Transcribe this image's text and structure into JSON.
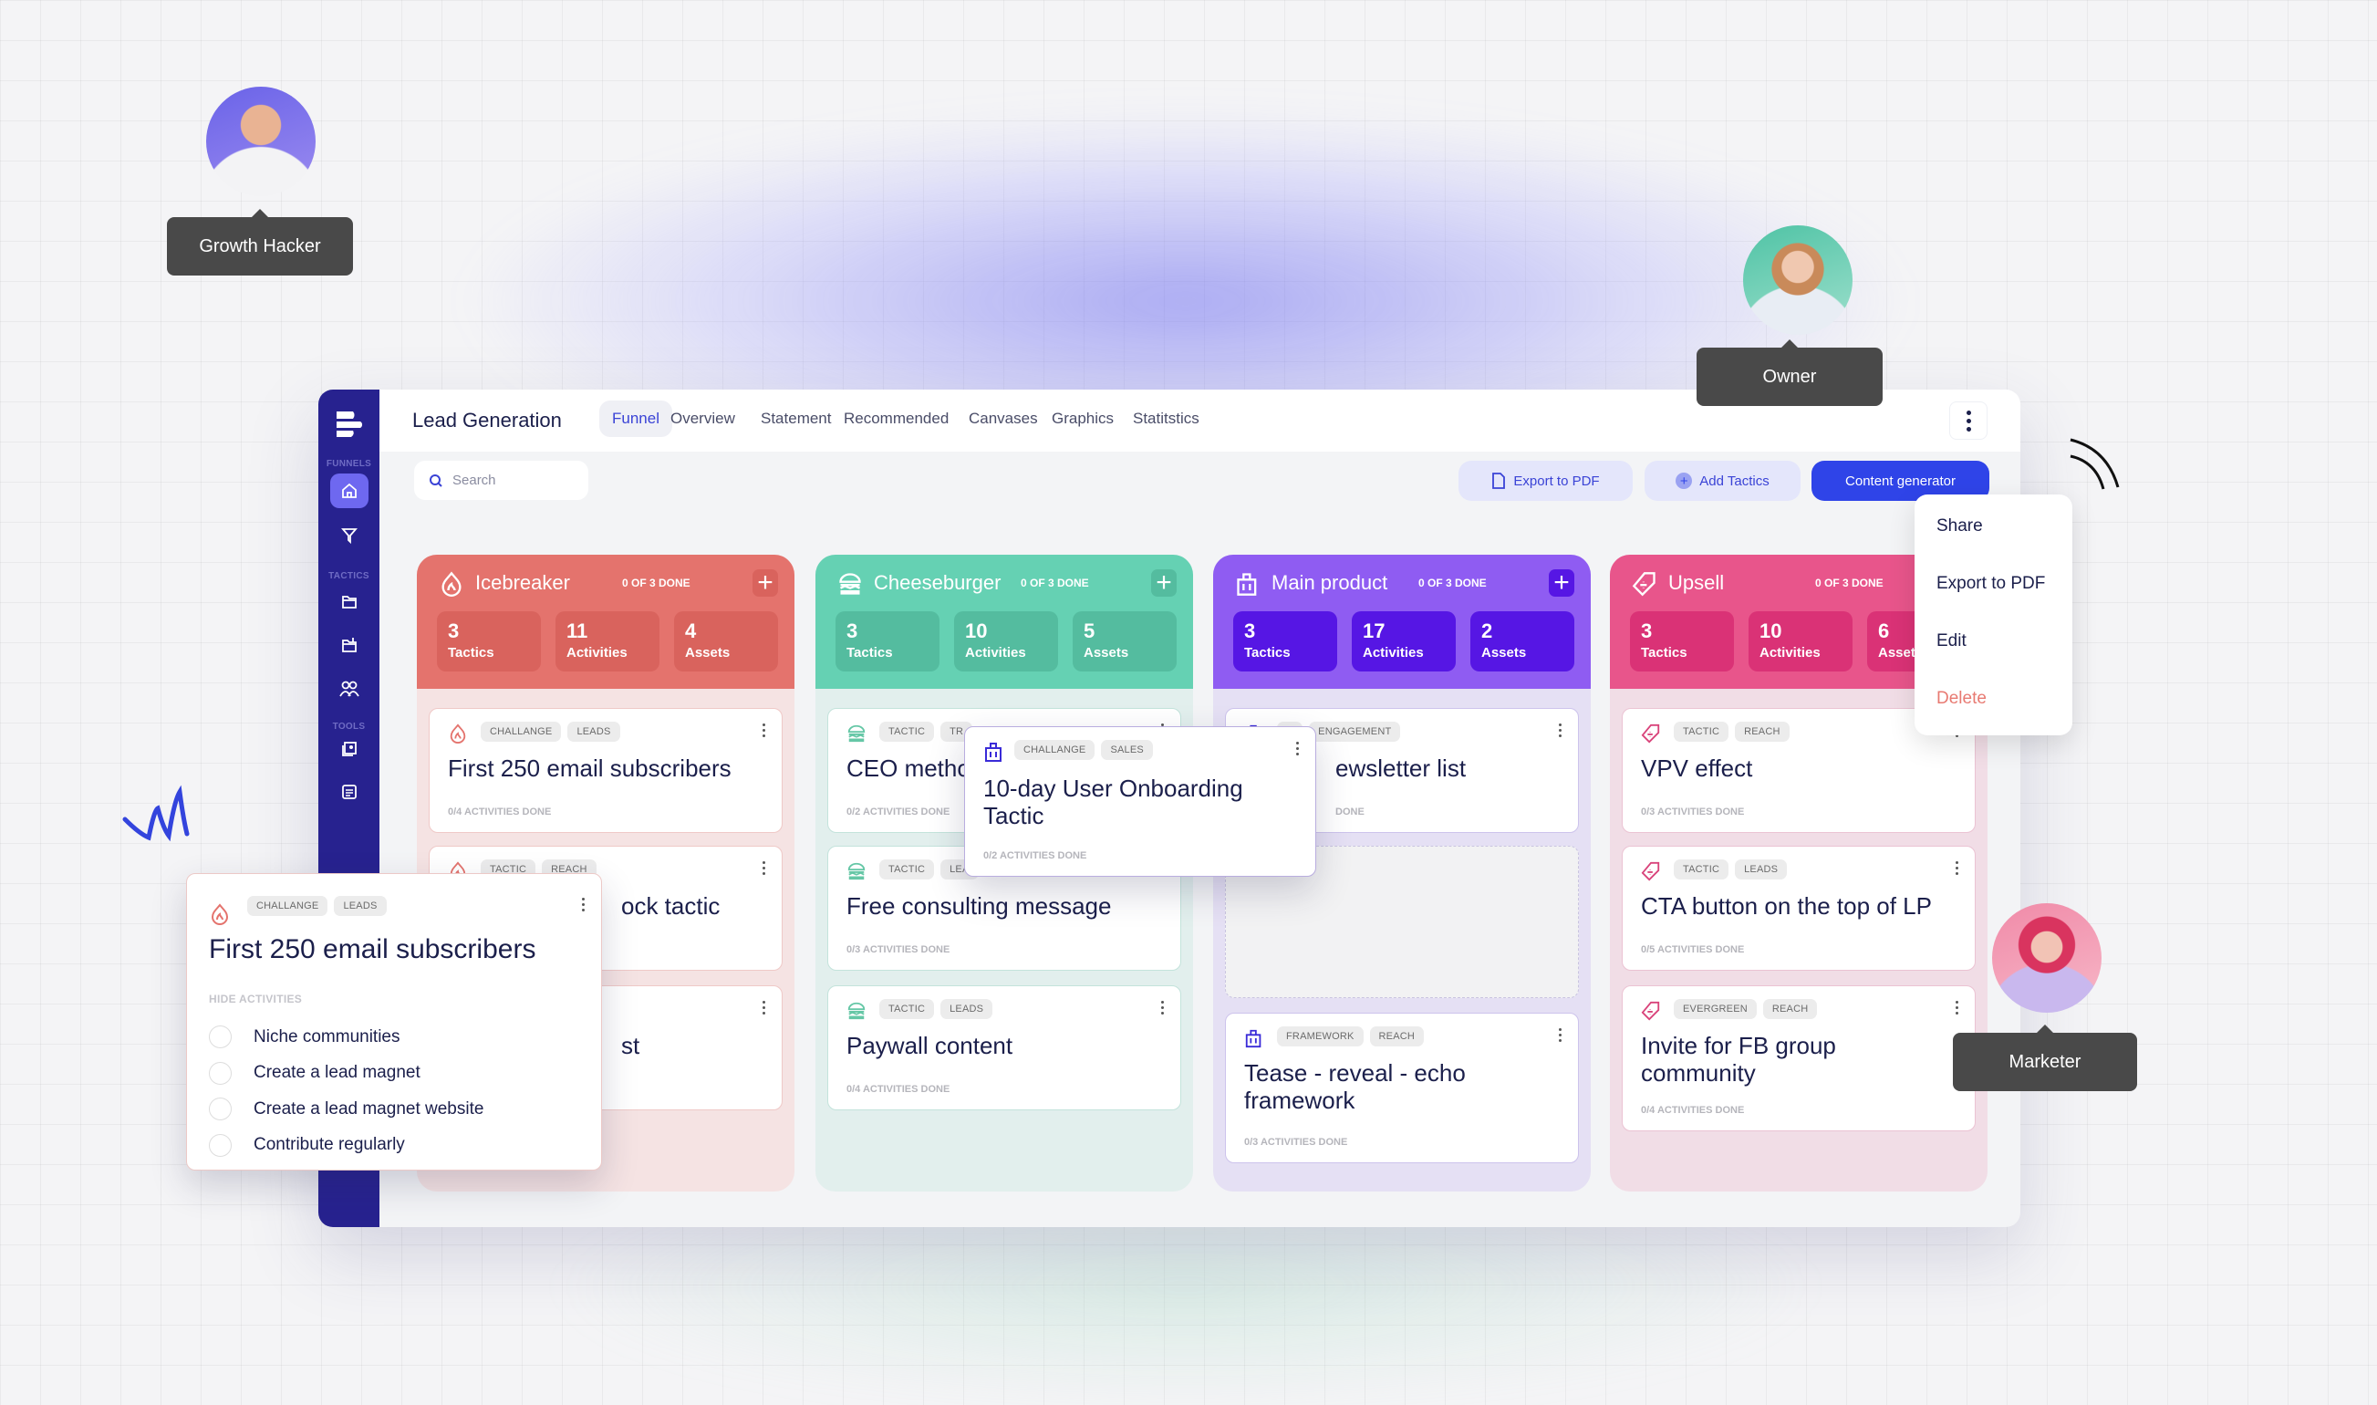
{
  "app": {
    "title": "Lead Generation",
    "tabs": [
      "Funnel",
      "Overview",
      "Statement",
      "Recommended",
      "Canvases",
      "Graphics",
      "Statitstics"
    ],
    "active_tab": "Funnel"
  },
  "sidebar": {
    "sections": [
      "FUNNELS",
      "TACTICS",
      "TOOLS"
    ],
    "icons": [
      "home-icon",
      "funnel-icon",
      "folder-icon",
      "folder-add-icon",
      "users-icon",
      "image-icon",
      "document-icon"
    ]
  },
  "search": {
    "placeholder": "Search"
  },
  "toolbar": {
    "export": "Export to PDF",
    "add": "Add Tactics",
    "generator": "Content generator"
  },
  "menu": {
    "items": [
      "Share",
      "Export to PDF",
      "Edit",
      "Delete"
    ]
  },
  "columns": [
    {
      "name": "Icebreaker",
      "done": "0 OF 3 DONE",
      "icon": "fire-icon",
      "color": "#e4736d",
      "stat_color": "#d9635d",
      "body": "#f5e3e3",
      "border": "#efc9c7",
      "stats": [
        {
          "n": "3",
          "l": "Tactics"
        },
        {
          "n": "11",
          "l": "Activities"
        },
        {
          "n": "4",
          "l": "Assets"
        }
      ],
      "cards": [
        {
          "tags": [
            "CHALLANGE",
            "LEADS"
          ],
          "title": "First 250 email subscribers",
          "meta": "0/4 ACTIVITIES DONE"
        },
        {
          "tags": [
            "TACTIC",
            "REACH"
          ],
          "title": "ock tactic",
          "meta": ""
        },
        {
          "tags": [],
          "title": "st",
          "meta": ""
        }
      ]
    },
    {
      "name": "Cheeseburger",
      "done": "0 OF 3 DONE",
      "icon": "burger-icon",
      "color": "#65d1b3",
      "stat_color": "#54bc9f",
      "body": "#e2efed",
      "border": "#c3e3db",
      "stats": [
        {
          "n": "3",
          "l": "Tactics"
        },
        {
          "n": "10",
          "l": "Activities"
        },
        {
          "n": "5",
          "l": "Assets"
        }
      ],
      "cards": [
        {
          "tags": [
            "TACTIC",
            "TR"
          ],
          "title": "CEO metho",
          "meta": "0/2 ACTIVITIES DONE"
        },
        {
          "tags": [
            "TACTIC",
            "LEA"
          ],
          "title": "Free consulting message",
          "meta": "0/3 ACTIVITIES DONE"
        },
        {
          "tags": [
            "TACTIC",
            "LEADS"
          ],
          "title": "Paywall content",
          "meta": "0/4 ACTIVITIES DONE"
        }
      ]
    },
    {
      "name": "Main product",
      "done": "0 OF 3 DONE",
      "icon": "shopping-bag-icon",
      "color": "#8f5cf2",
      "stat_color": "#5616e4",
      "body": "#e5e0f4",
      "border": "#cdc3ec",
      "stats": [
        {
          "n": "3",
          "l": "Tactics"
        },
        {
          "n": "17",
          "l": "Activities"
        },
        {
          "n": "2",
          "l": "Assets"
        }
      ],
      "cards": [
        {
          "tags": [
            "C",
            "ENGAGEMENT"
          ],
          "title": "ewsletter list",
          "meta": "DONE"
        },
        {
          "tags": [
            "FRAMEWORK",
            "REACH"
          ],
          "title": "Tease - reveal - echo framework",
          "meta": "0/3 ACTIVITIES DONE"
        }
      ]
    },
    {
      "name": "Upsell",
      "done": "0 OF 3 DONE",
      "icon": "tag-icon",
      "color": "#e8558b",
      "stat_color": "#da3276",
      "body": "#f1dde6",
      "border": "#ebc3d3",
      "stats": [
        {
          "n": "3",
          "l": "Tactics"
        },
        {
          "n": "10",
          "l": "Activities"
        },
        {
          "n": "6",
          "l": "Assets"
        }
      ],
      "cards": [
        {
          "tags": [
            "TACTIC",
            "REACH"
          ],
          "title": "VPV effect",
          "meta": "0/3 ACTIVITIES DONE"
        },
        {
          "tags": [
            "TACTIC",
            "LEADS"
          ],
          "title": "CTA button on the top of LP",
          "meta": "0/5 ACTIVITIES DONE"
        },
        {
          "tags": [
            "EVERGREEN",
            "REACH"
          ],
          "title": "Invite for FB group community",
          "meta": "0/4 ACTIVITIES DONE"
        }
      ]
    }
  ],
  "drag_card": {
    "tags": [
      "CHALLANGE",
      "SALES"
    ],
    "title": "10-day User Onboarding Tactic",
    "meta": "0/2 ACTIVITIES DONE"
  },
  "expanded_card": {
    "tags": [
      "CHALLANGE",
      "LEADS"
    ],
    "title": "First 250 email subscribers",
    "toggle": "HIDE ACTIVITIES",
    "activities": [
      "Niche communities",
      "Create a lead magnet",
      "Create a lead magnet website",
      "Contribute regularly"
    ]
  },
  "people": [
    {
      "role": "Growth Hacker"
    },
    {
      "role": "Owner"
    },
    {
      "role": "Marketer"
    }
  ]
}
